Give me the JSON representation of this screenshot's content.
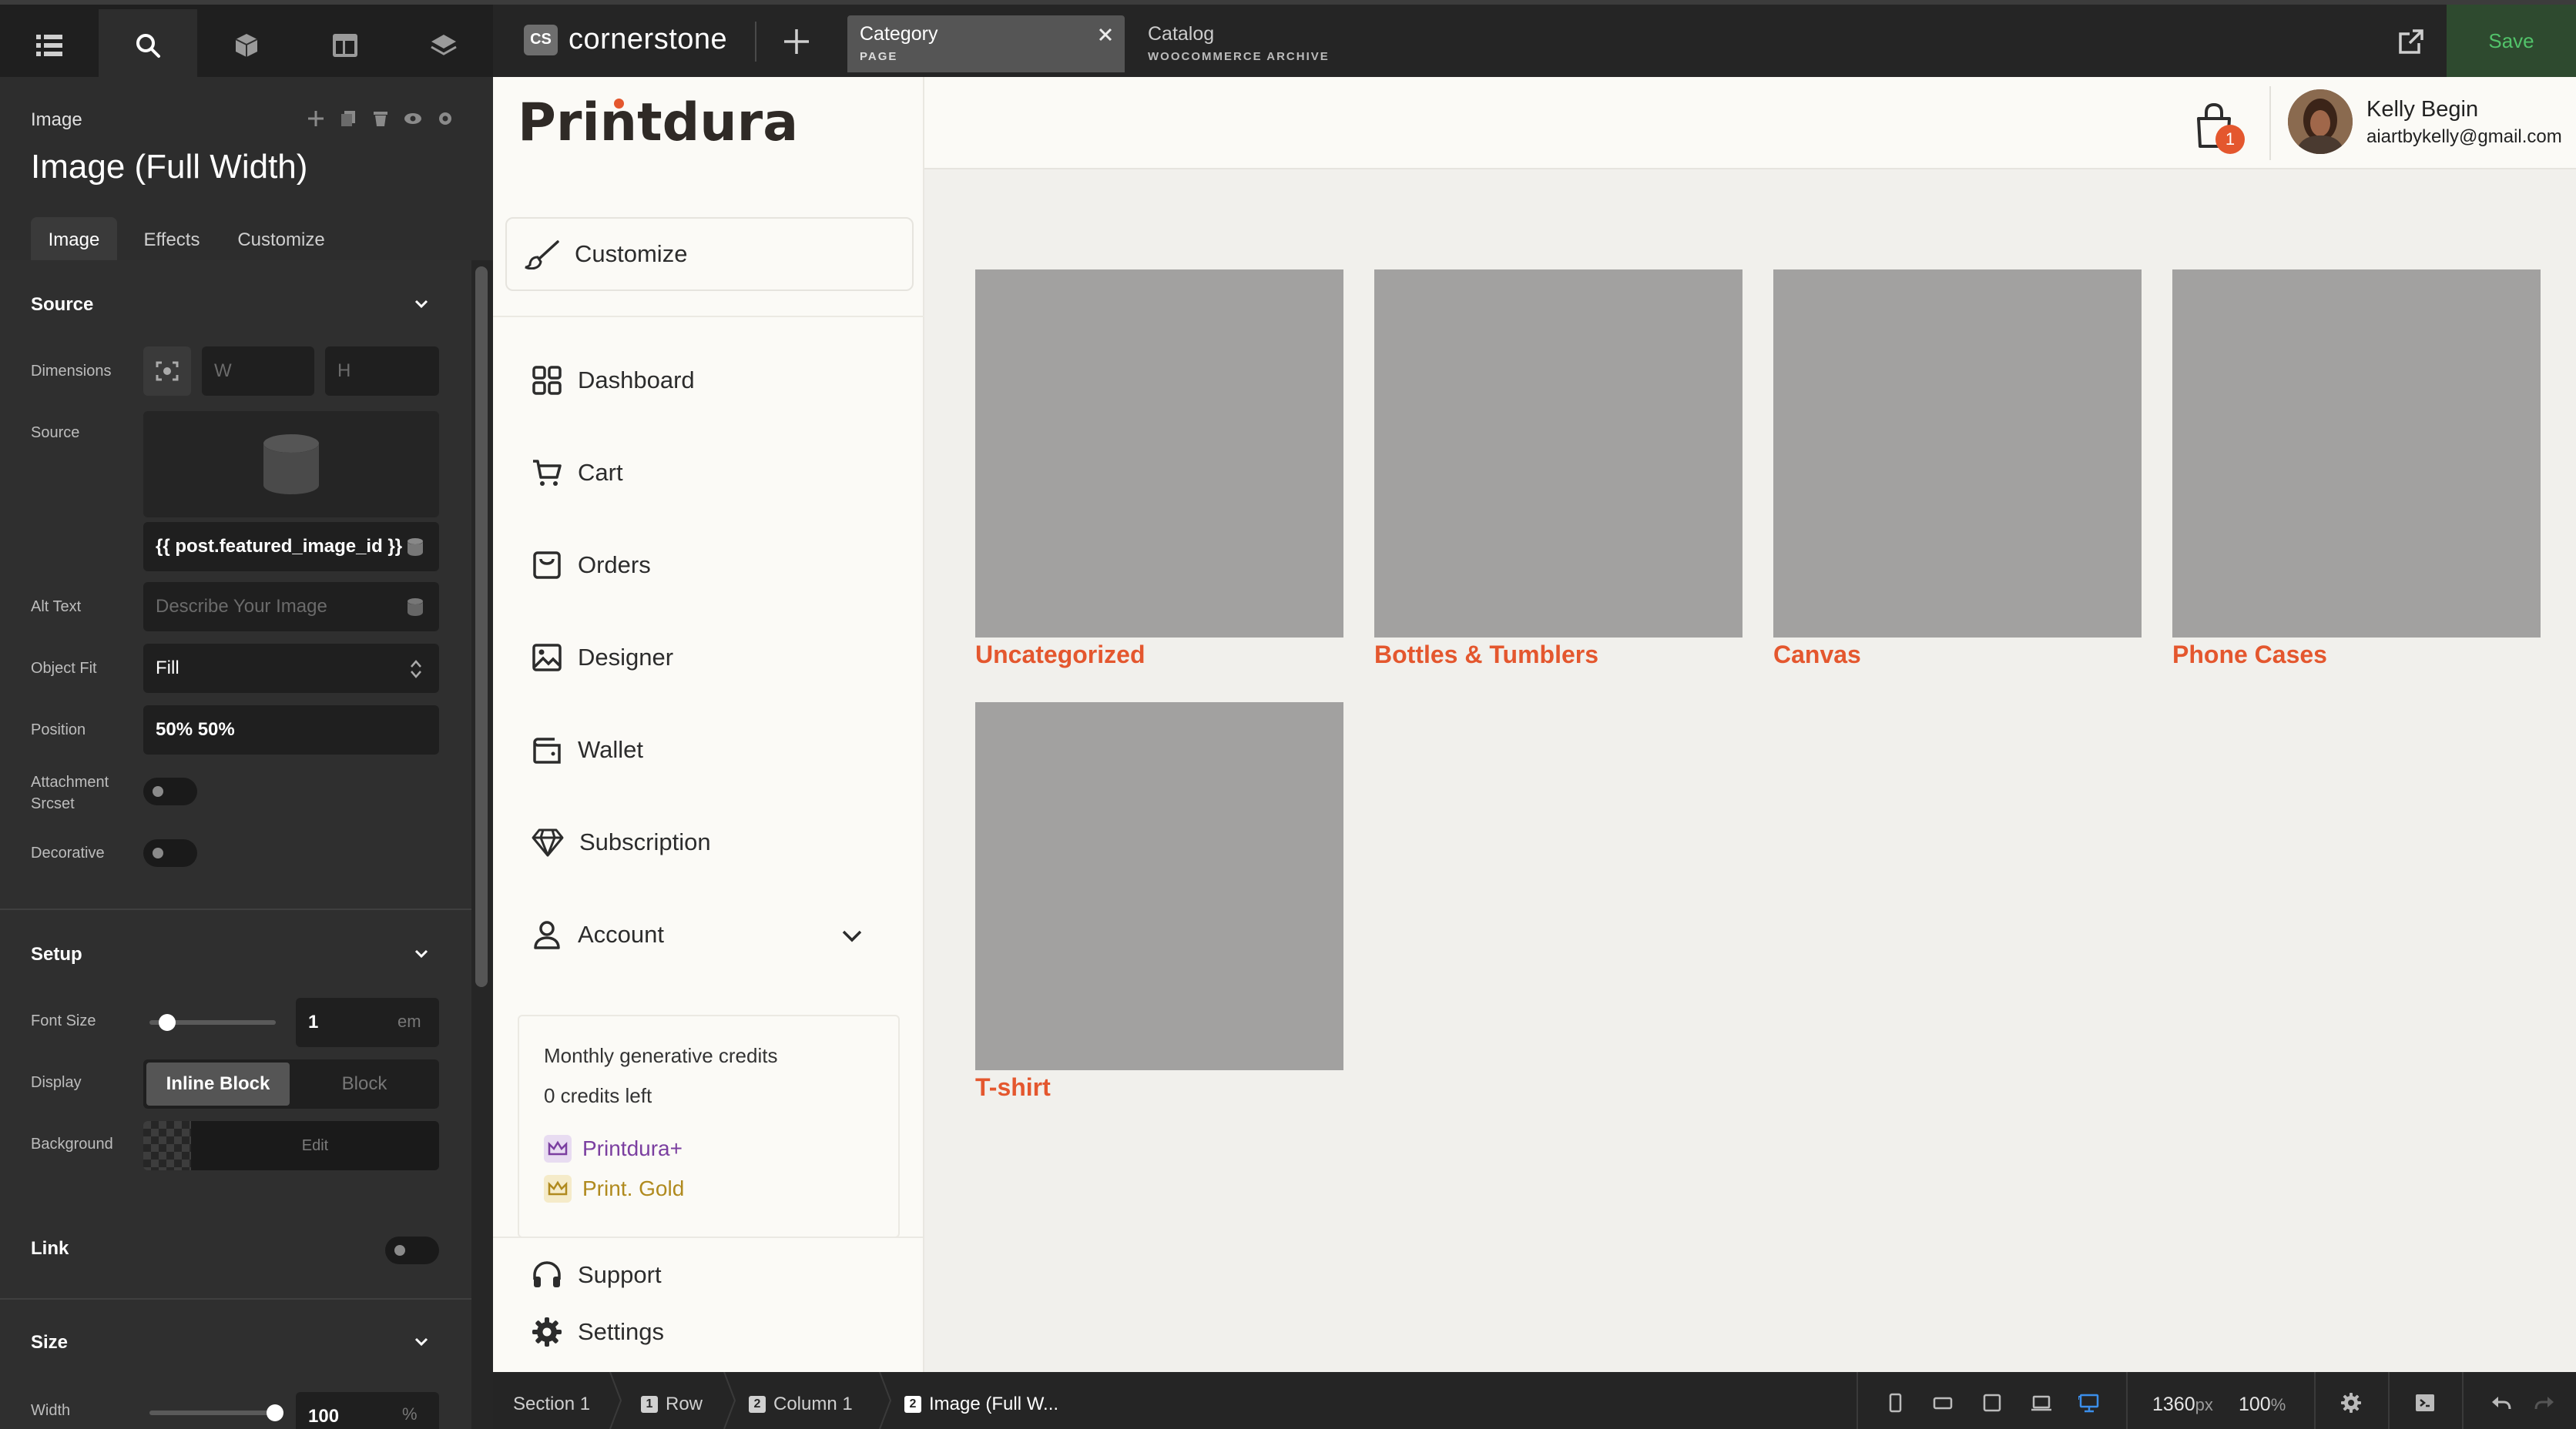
{
  "builder": {
    "app_name": "cornerstone",
    "app_badge": "CS",
    "save_label": "Save",
    "tabs": [
      {
        "title": "Category",
        "subtitle": "PAGE"
      },
      {
        "title": "Catalog",
        "subtitle": "WOOCOMMERCE ARCHIVE"
      }
    ]
  },
  "inspector": {
    "element_kind": "Image",
    "element_title": "Image (Full Width)",
    "tabs": [
      "Image",
      "Effects",
      "Customize"
    ],
    "sections": {
      "source": "Source",
      "setup": "Setup",
      "link": "Link",
      "size": "Size"
    },
    "fields": {
      "dimensions_label": "Dimensions",
      "w_placeholder": "W",
      "h_placeholder": "H",
      "source_label": "Source",
      "source_value": "{{ post.featured_image_id }}",
      "alt_label": "Alt Text",
      "alt_placeholder": "Describe Your Image",
      "object_fit_label": "Object Fit",
      "object_fit_value": "Fill",
      "position_label": "Position",
      "position_value": "50% 50%",
      "attachment_label_1": "Attachment",
      "attachment_label_2": "Srcset",
      "decorative_label": "Decorative",
      "font_size_label": "Font Size",
      "font_size_value": "1",
      "font_size_unit": "em",
      "display_label": "Display",
      "display_options": [
        "Inline Block",
        "Block"
      ],
      "background_label": "Background",
      "background_edit": "Edit",
      "width_label": "Width",
      "width_value": "100",
      "width_unit": "%"
    }
  },
  "site": {
    "brand": "Printdura",
    "customize_label": "Customize",
    "nav": [
      "Dashboard",
      "Cart",
      "Orders",
      "Designer",
      "Wallet",
      "Subscription",
      "Account"
    ],
    "credits_title": "Monthly generative credits",
    "credits_left": "0 credits left",
    "plans": [
      {
        "name": "Printdura+",
        "color": "#7b3fa0"
      },
      {
        "name": "Print. Gold",
        "color": "#b08a1e"
      }
    ],
    "bottom_nav": [
      "Support",
      "Settings"
    ],
    "cart_count": "1",
    "user_name": "Kelly Begin",
    "user_email": "aiartbykelly@gmail.com",
    "categories": [
      "Uncategorized",
      "Bottles & Tumblers",
      "Canvas",
      "Phone Cases",
      "T-shirt"
    ],
    "accent": "#e4572e"
  },
  "bottombar": {
    "crumbs": [
      {
        "num": "",
        "label": "Section 1"
      },
      {
        "num": "1",
        "label": "Row"
      },
      {
        "num": "2",
        "label": "Column 1"
      },
      {
        "num": "2",
        "label": "Image (Full W..."
      }
    ],
    "viewport_width": "1360",
    "viewport_unit": "px",
    "zoom": "100",
    "zoom_unit": "%"
  }
}
